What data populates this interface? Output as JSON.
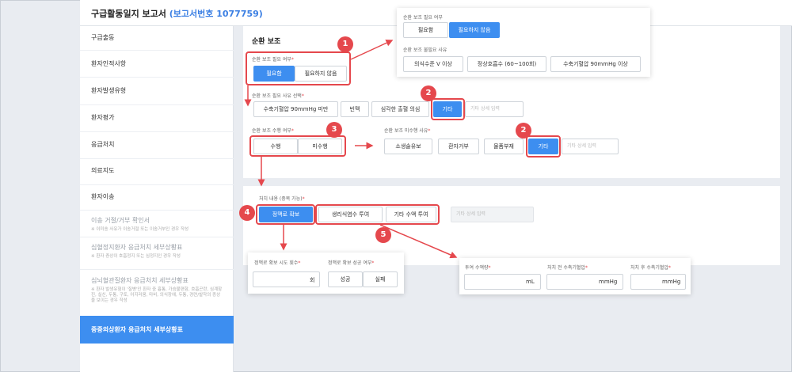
{
  "header": {
    "title": "구급활동일지 보고서",
    "report_no": "(보고서번호 1077759)"
  },
  "sidebar": {
    "items": [
      {
        "label": "구급출동"
      },
      {
        "label": "환자인적사항"
      },
      {
        "label": "환자발생유형"
      },
      {
        "label": "환자평가"
      },
      {
        "label": "응급처치"
      },
      {
        "label": "의료지도"
      },
      {
        "label": "환자이송"
      },
      {
        "label": "이송 거절/거부 확인서",
        "sub": "※ 이미송 사유가 이송거절 또는 이송거부인 경우 작성"
      },
      {
        "label": "심혈정지환자 응급처치 세부상황표",
        "sub": "※ 환자 증상이 호흡정지 또는 심정지인 경우 작성"
      },
      {
        "label": "심뇌혈관질환자 응급처치 세부상황표",
        "sub": "※ 환자 발생유형이 '질병'인 환자 중 흉통, 가슴불편함, 호흡곤란, 심계항진, 실신, 두통, 구토, 어지러움, 마비, 의식장애, 두통, 경련/발작의 증상을 보이는 경우 작성"
      },
      {
        "label": "중증외상환자 응급처치 세부상황표"
      }
    ]
  },
  "section": {
    "title": "순환 보조"
  },
  "need": {
    "label": "순환 보조 필요 여부",
    "required": "*",
    "options": [
      "필요함",
      "필요하지 않음"
    ]
  },
  "need_reason": {
    "label": "순환 보조 필요 사유 선택",
    "required": "*",
    "options": [
      "수축기혈압 90mmHg 미만",
      "빈맥",
      "심각한 출혈 의심",
      "기타"
    ],
    "placeholder": "기타 상세 입력"
  },
  "popup_need": {
    "label": "순환 보조 필요 여부",
    "options": [
      "필요함",
      "필요하지 않음"
    ],
    "reason_label": "순환 보조 불필요 사유",
    "reasons": [
      "의식수준 V 이상",
      "정상호흡수 (60~100회)",
      "수축기혈압 90mmHg 이상"
    ]
  },
  "perform": {
    "label": "순환 보조 수행 여부",
    "required": "*",
    "options": [
      "수행",
      "미수행"
    ]
  },
  "not_perform": {
    "label": "순환 보조 미수행 사유",
    "required": "*",
    "options": [
      "소생술유보",
      "환자거부",
      "물품부재",
      "기타"
    ],
    "placeholder": "기타 상세 입력"
  },
  "treat": {
    "label": "처치 내용 (중복 가능)",
    "required": "*",
    "options": [
      "정맥로 확보",
      "생리식염수 투여",
      "기타 수액 투여"
    ],
    "placeholder": "기타 상세 입력"
  },
  "iv_popup": {
    "attempts_label": "정맥로 확보 시도 횟수",
    "attempts_unit": "회",
    "success_label": "정맥로 확보 성공 여부",
    "success_options": [
      "성공",
      "실패"
    ]
  },
  "fluid_popup": {
    "amount_label": "투여 수액량",
    "amount_unit": "mL",
    "pre_label": "처치 전 수축기혈압",
    "pre_unit": "mmHg",
    "post_label": "처치 후 수축기혈압",
    "post_unit": "mmHg"
  },
  "badges": [
    "1",
    "2",
    "2",
    "3",
    "4",
    "5"
  ],
  "colors": {
    "accent": "#3d8ef0",
    "highlight": "#e5484d"
  }
}
